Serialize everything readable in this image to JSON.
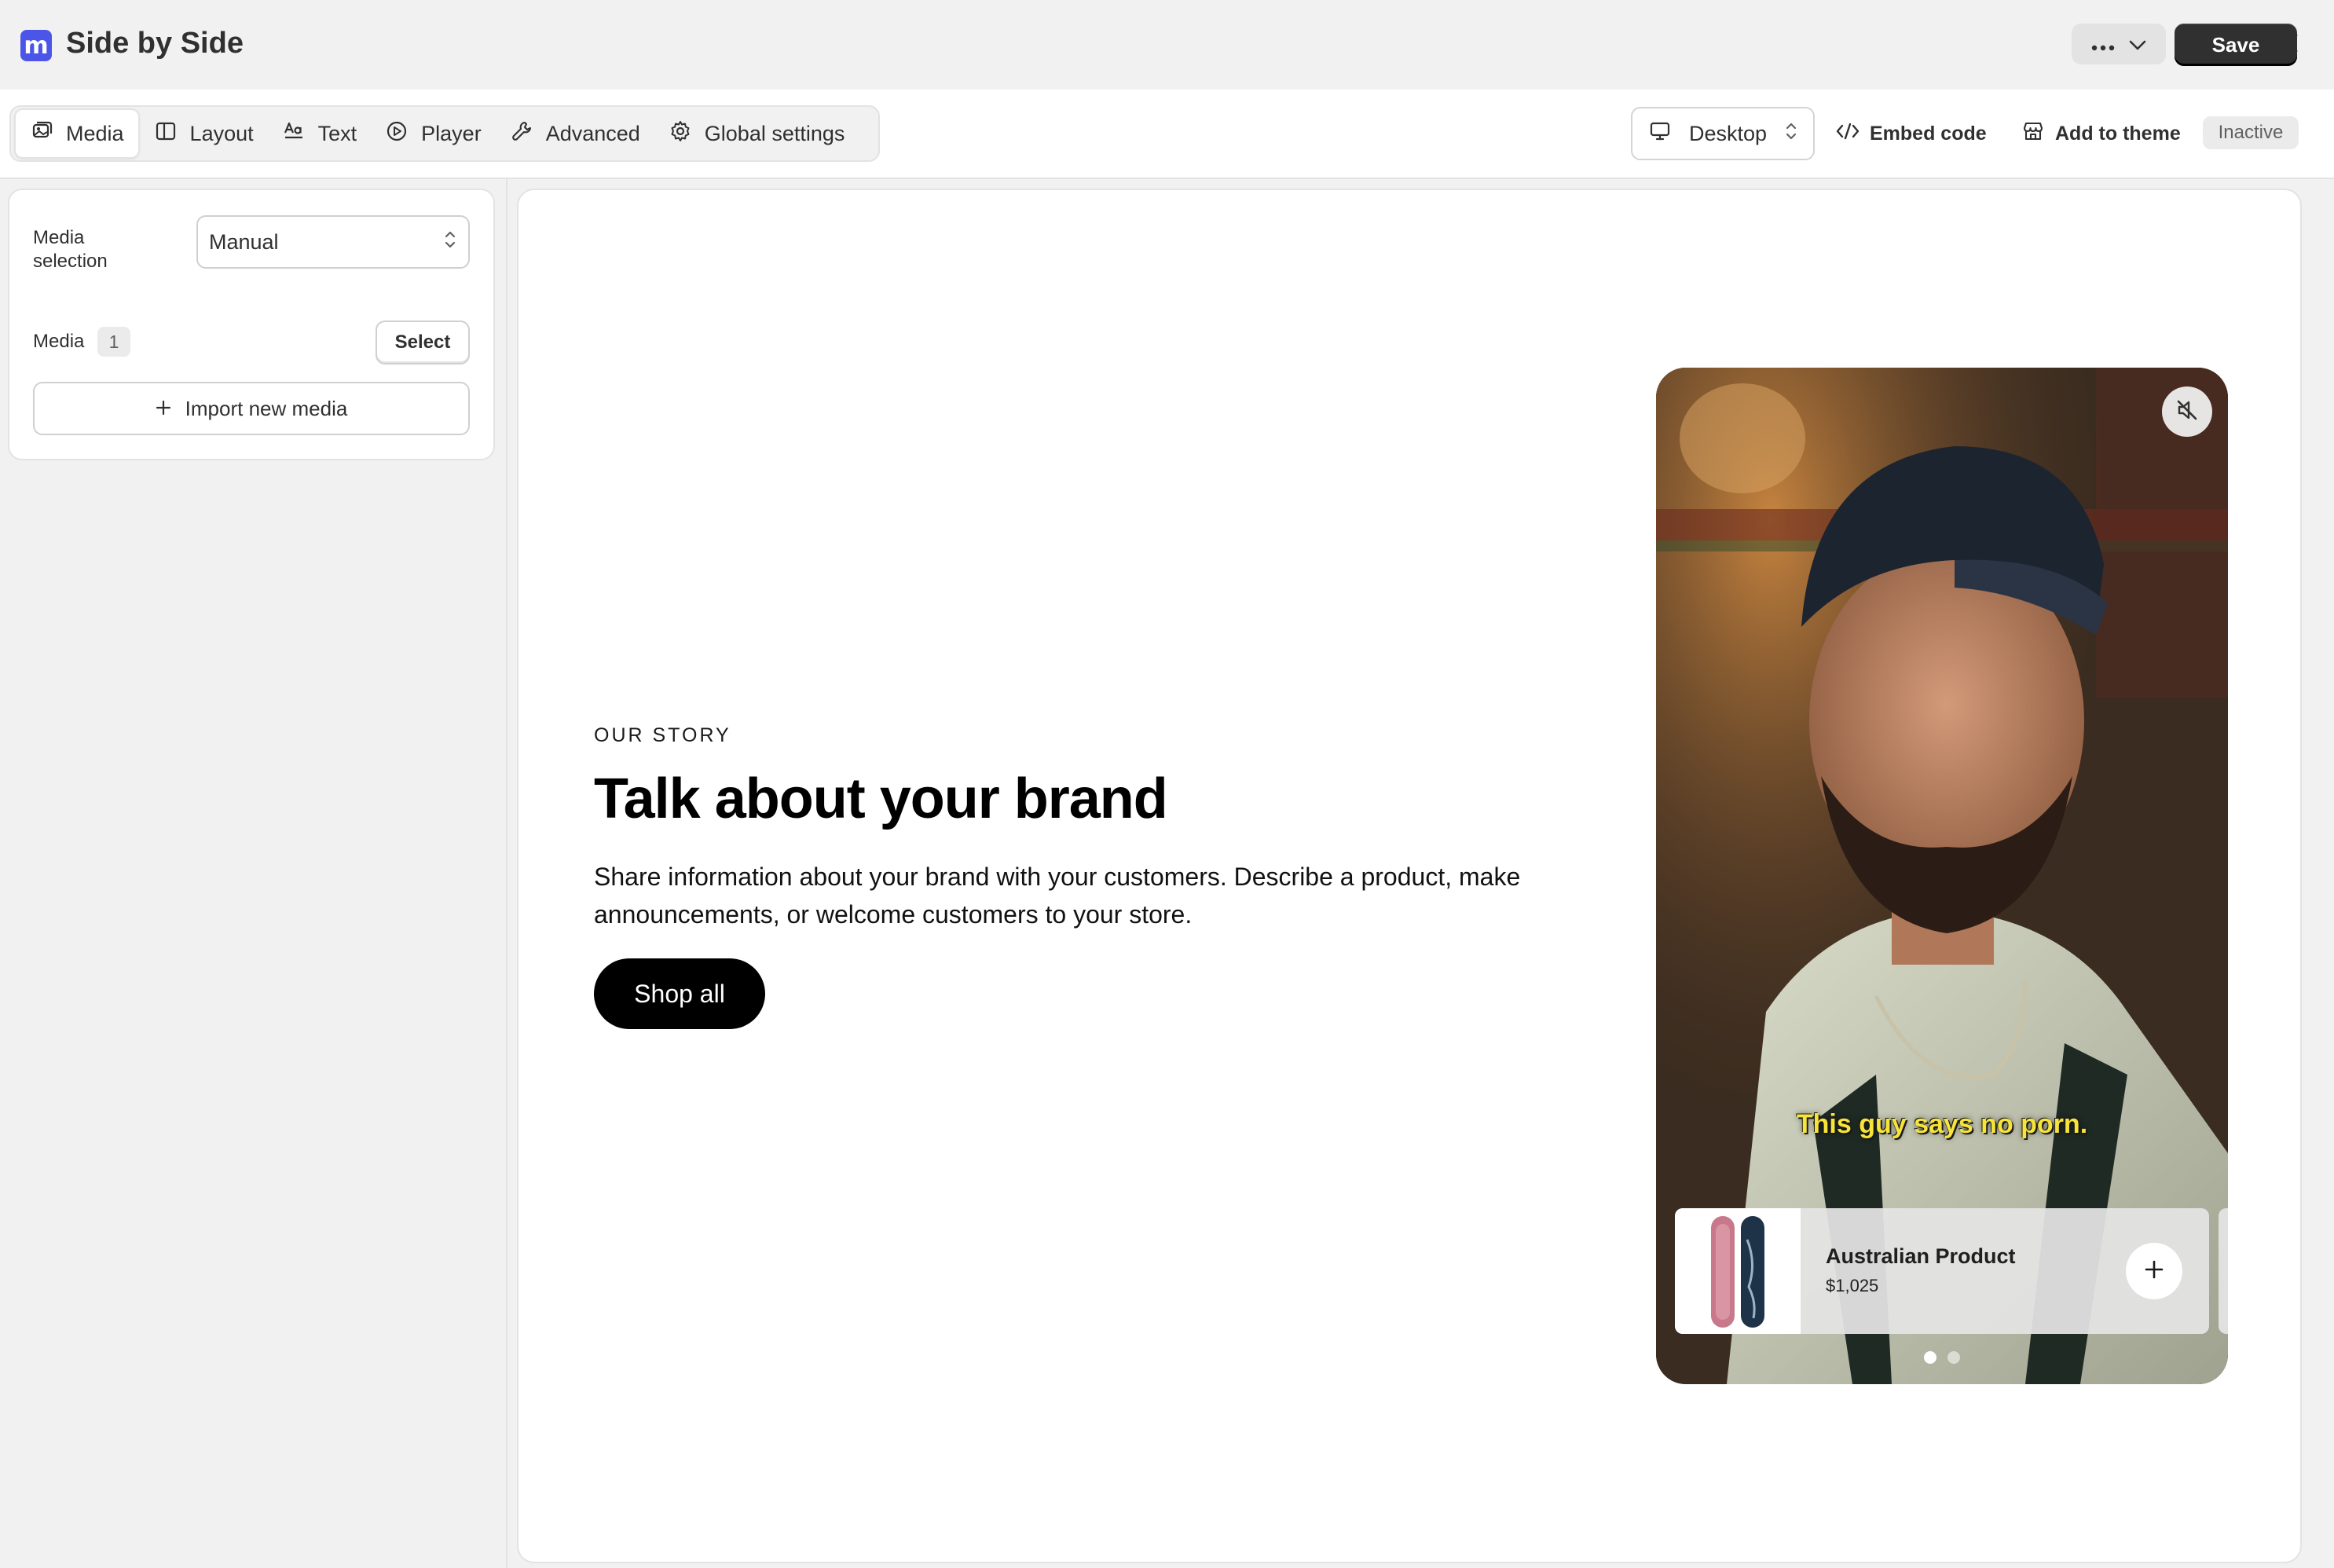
{
  "app": {
    "logo_letter": "m",
    "title": "Side by Side",
    "more_icon": "ellipsis-icon",
    "save_label": "Save"
  },
  "tabs": [
    {
      "label": "Media",
      "icon": "image-icon",
      "active": true
    },
    {
      "label": "Layout",
      "icon": "layout-icon",
      "active": false
    },
    {
      "label": "Text",
      "icon": "text-icon",
      "active": false
    },
    {
      "label": "Player",
      "icon": "play-icon",
      "active": false
    },
    {
      "label": "Advanced",
      "icon": "wrench-icon",
      "active": false
    },
    {
      "label": "Global settings",
      "icon": "gear-icon",
      "active": false
    }
  ],
  "toolbar": {
    "device": "Desktop",
    "embed_label": "Embed code",
    "add_theme_label": "Add to theme",
    "status": "Inactive"
  },
  "panel": {
    "media_selection_label": "Media selection",
    "media_selection_value": "Manual",
    "media_label": "Media",
    "media_count": "1",
    "select_label": "Select",
    "import_label": "Import new media"
  },
  "preview": {
    "eyebrow": "OUR STORY",
    "headline": "Talk about your brand",
    "body": "Share information about your brand with your customers. Describe a product, make announcements, or welcome customers to your store.",
    "cta_label": "Shop all",
    "video": {
      "caption": "This guy says no porn.",
      "product_name": "Australian Product",
      "product_price": "$1,025",
      "slide_index": 1,
      "slide_count": 2
    }
  },
  "colors": {
    "accent": "#4b55e8",
    "primary_button": "#303030",
    "caption": "#f7e43a"
  }
}
